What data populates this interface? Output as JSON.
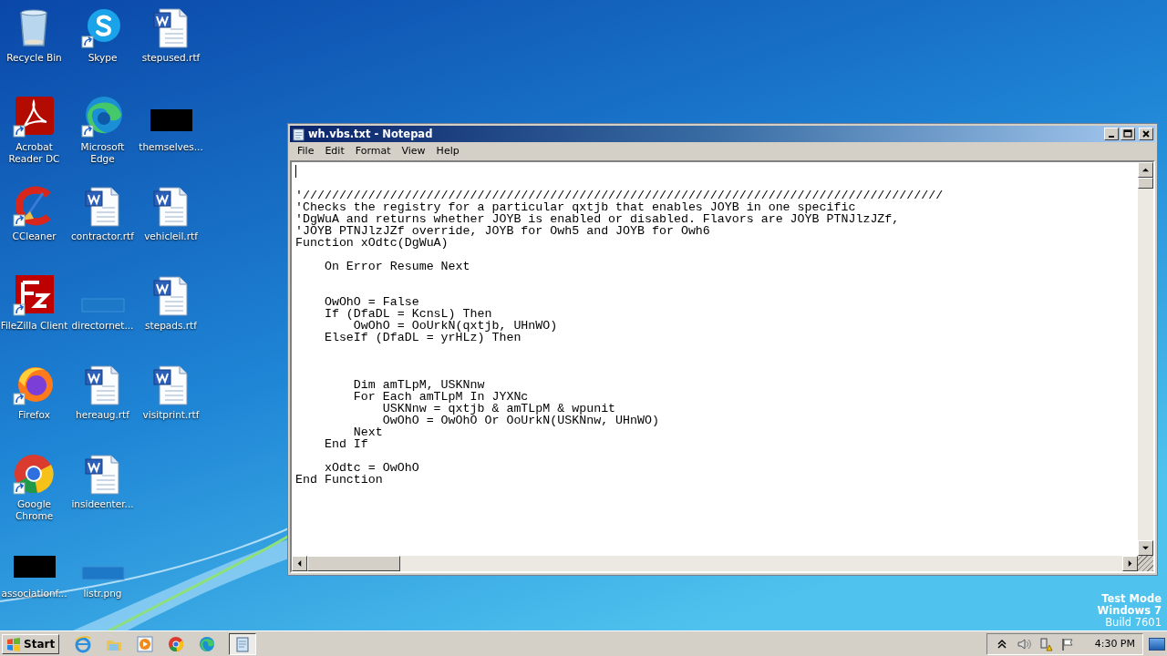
{
  "desktop": {
    "rows": [
      {
        "icons": [
          {
            "kind": "recycle",
            "label": "Recycle Bin",
            "shortcut": false
          },
          {
            "kind": "skype",
            "label": "Skype",
            "shortcut": true
          },
          {
            "kind": "word",
            "label": "stepused.rtf",
            "shortcut": false
          }
        ]
      },
      {
        "icons": [
          {
            "kind": "acrobat",
            "label": "Acrobat Reader DC",
            "shortcut": true
          },
          {
            "kind": "edge",
            "label": "Microsoft Edge",
            "shortcut": true
          },
          {
            "kind": "redacted",
            "label": "themselves...",
            "shortcut": false
          }
        ]
      },
      {
        "icons": [
          {
            "kind": "ccleaner",
            "label": "CCleaner",
            "shortcut": true
          },
          {
            "kind": "word",
            "label": "contractor.rtf",
            "shortcut": false
          },
          {
            "kind": "word",
            "label": "vehicleil.rtf",
            "shortcut": false
          }
        ]
      },
      {
        "icons": [
          {
            "kind": "filezilla",
            "label": "FileZilla Client",
            "shortcut": true
          },
          {
            "kind": "blank",
            "label": "directornet...",
            "shortcut": false
          },
          {
            "kind": "word",
            "label": "stepads.rtf",
            "shortcut": false
          }
        ]
      },
      {
        "icons": [
          {
            "kind": "firefox",
            "label": "Firefox",
            "shortcut": true
          },
          {
            "kind": "word",
            "label": "hereaug.rtf",
            "shortcut": false
          },
          {
            "kind": "word",
            "label": "visitprint.rtf",
            "shortcut": false
          }
        ]
      },
      {
        "icons": [
          {
            "kind": "chrome",
            "label": "Google Chrome",
            "shortcut": true
          },
          {
            "kind": "word",
            "label": "insideenter...",
            "shortcut": false
          }
        ]
      },
      {
        "icons": [
          {
            "kind": "redacted",
            "label": "associationf...",
            "shortcut": false
          },
          {
            "kind": "blank",
            "label": "listr.png",
            "shortcut": false
          }
        ]
      }
    ],
    "watermark": [
      "Test Mode",
      "Windows 7",
      "Build 7601"
    ]
  },
  "window": {
    "title": "wh.vbs.txt - Notepad",
    "menu": [
      "File",
      "Edit",
      "Format",
      "View",
      "Help"
    ],
    "content": "\n\n'////////////////////////////////////////////////////////////////////////////////////////\n'Checks the registry for a particular qxtjb that enables JOYB in one specific\n'DgWuA and returns whether JOYB is enabled or disabled. Flavors are JOYB PTNJlzJZf,\n'JOYB PTNJlzJZf override, JOYB for Owh5 and JOYB for Owh6\nFunction xOdtc(DgWuA)\n\n    On Error Resume Next\n\n\n    OwOhO = False\n    If (DfaDL = KcnsL) Then\n        OwOhO = OoUrkN(qxtjb, UHnWO)\n    ElseIf (DfaDL = yrHLz) Then\n\n\n\n        Dim amTLpM, USKNnw\n        For Each amTLpM In JYXNc\n            USKNnw = qxtjb & amTLpM & wpunit\n            OwOhO = OwOhO Or OoUrkN(USKNnw, UHnWO)\n        Next\n    End If\n\n    xOdtc = OwOhO\nEnd Function"
  },
  "taskbar": {
    "start": "Start",
    "quick_launch": [
      {
        "kind": "ie"
      },
      {
        "kind": "folder"
      },
      {
        "kind": "media"
      },
      {
        "kind": "chrome"
      },
      {
        "kind": "edge"
      }
    ],
    "tasks": [
      {
        "kind": "notepad",
        "selected": true
      }
    ],
    "tray": [
      {
        "kind": "chevron"
      },
      {
        "kind": "speaker"
      },
      {
        "kind": "network"
      },
      {
        "kind": "flag"
      }
    ],
    "clock": "4:30 PM"
  }
}
